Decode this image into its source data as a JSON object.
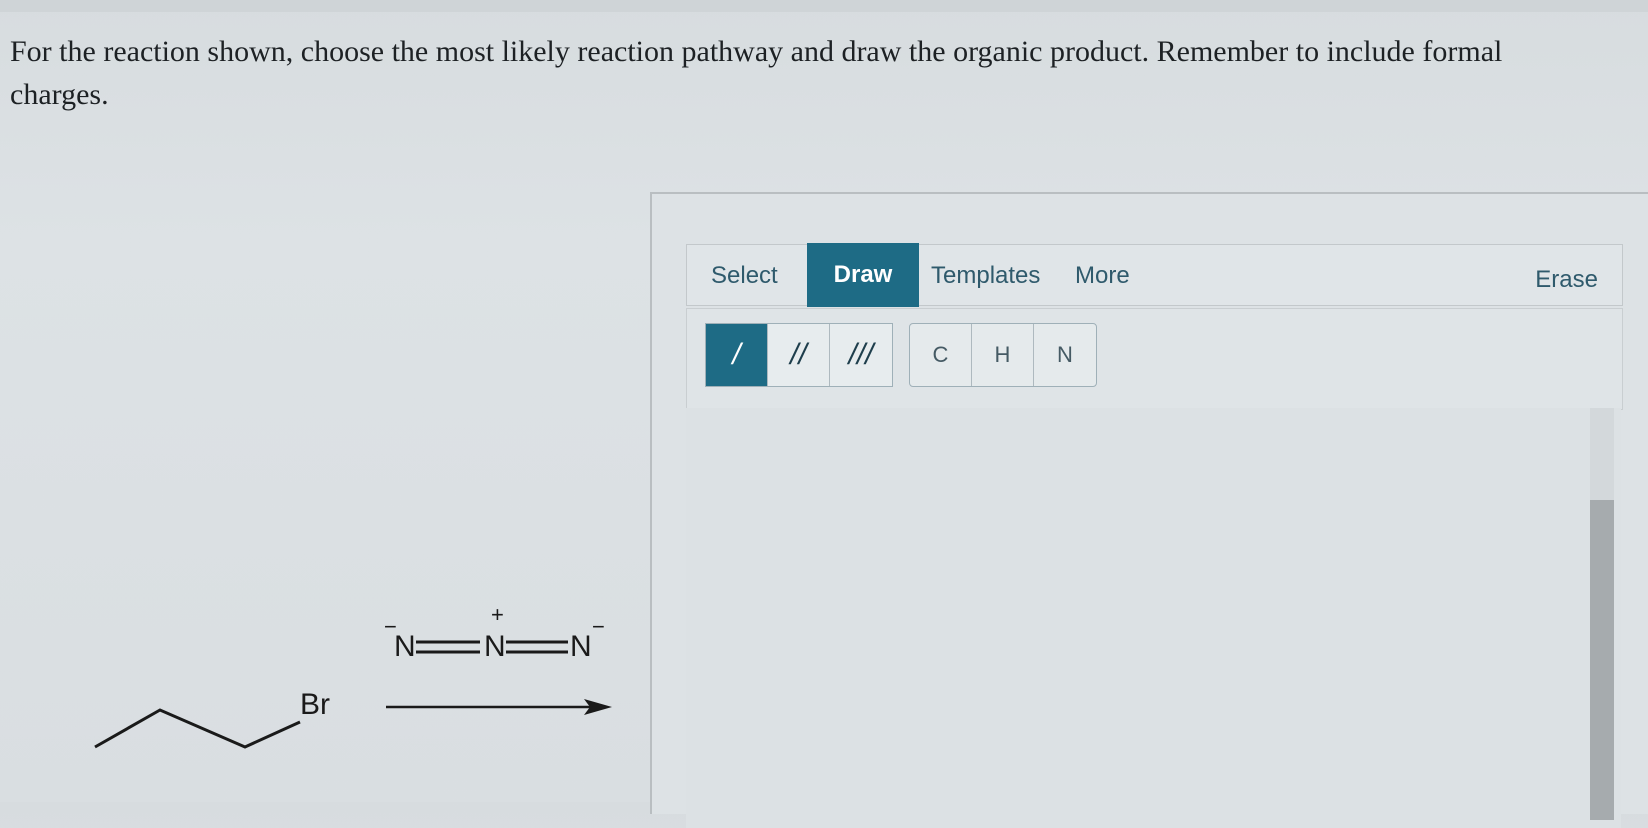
{
  "question": {
    "text": "For the reaction shown, choose the most likely reaction pathway and draw the organic product. Remember to include formal charges."
  },
  "reaction": {
    "substrate_label": "Br",
    "reagent": {
      "left_atom": "N",
      "center_atom": "N",
      "right_atom": "N",
      "left_charge": "−",
      "center_charge": "+",
      "right_charge": "−"
    }
  },
  "toolbar": {
    "tabs": {
      "select": "Select",
      "draw": "Draw",
      "templates": "Templates",
      "more": "More",
      "erase": "Erase"
    },
    "active_tab": "Draw"
  },
  "bond_tools": [
    {
      "label": "/",
      "name": "single-bond",
      "active": true
    },
    {
      "label": "//",
      "name": "double-bond",
      "active": false
    },
    {
      "label": "///",
      "name": "triple-bond",
      "active": false
    }
  ],
  "atom_tools": [
    "C",
    "H",
    "N"
  ],
  "colors": {
    "accent": "#1e6b85",
    "tab_text": "#2f5a6c",
    "background": "#dde2e5"
  }
}
